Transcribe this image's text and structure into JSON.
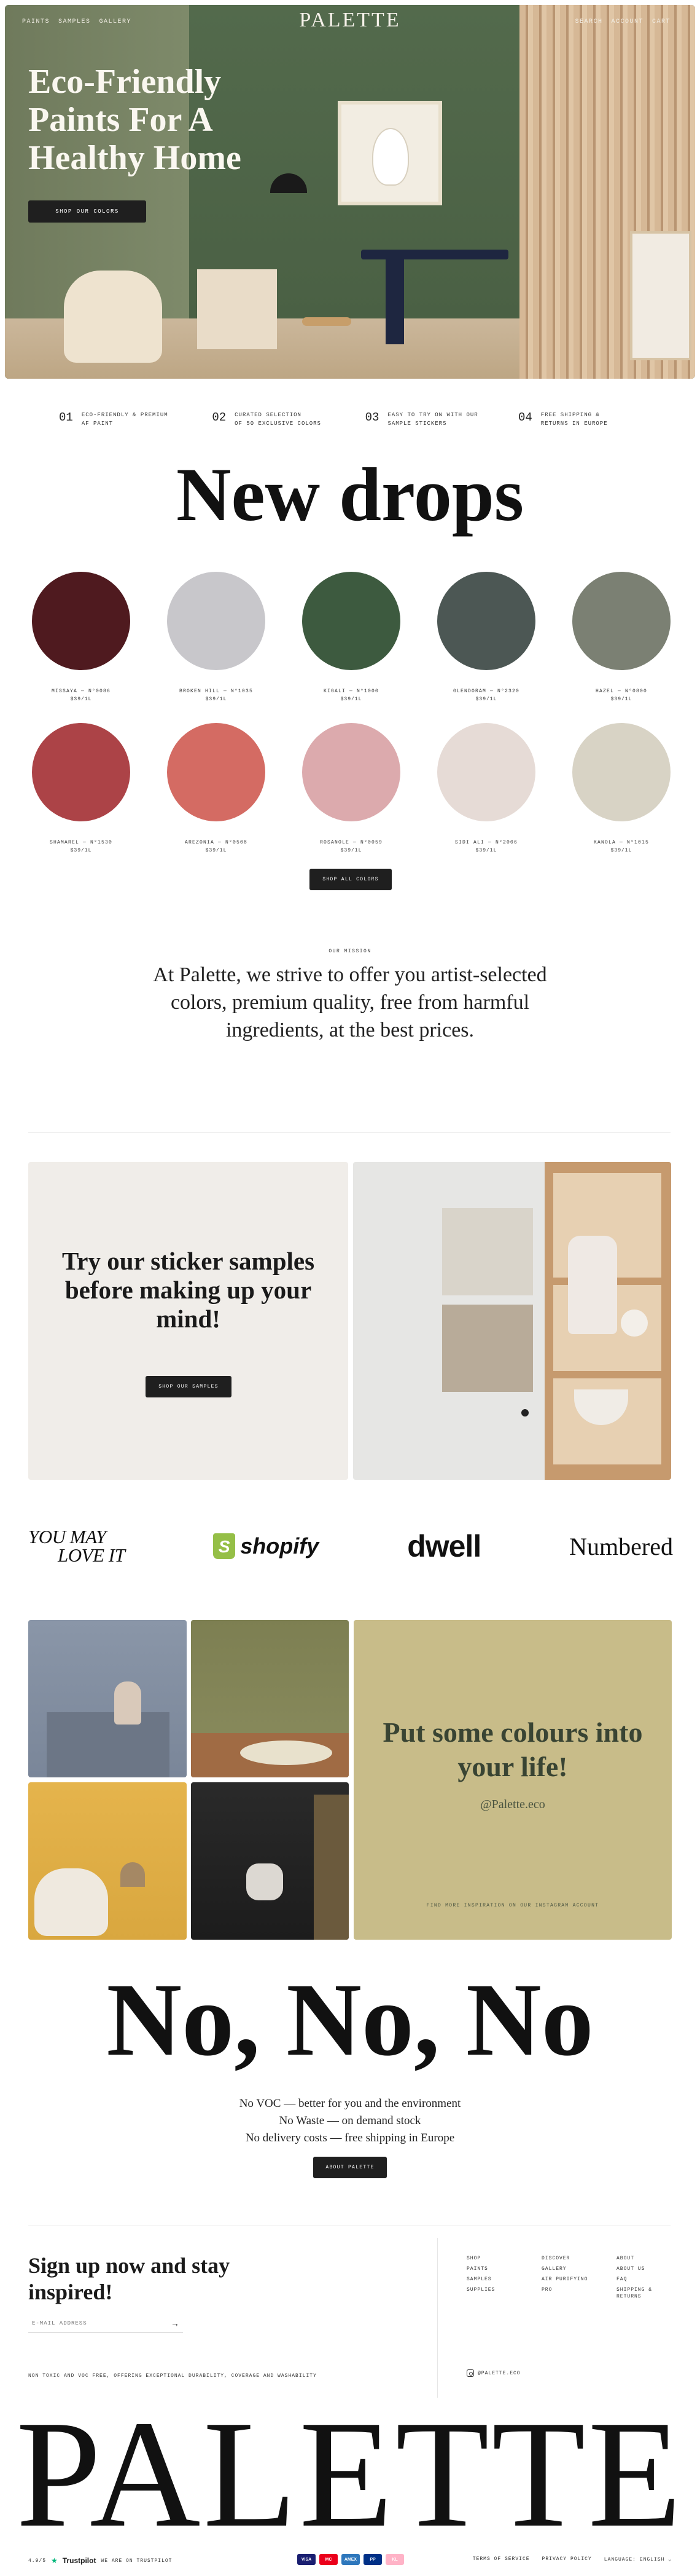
{
  "hero": {
    "nav_left": [
      "PAINTS",
      "SAMPLES",
      "GALLERY"
    ],
    "logo": "PALETTE",
    "nav_right": [
      "SEARCH",
      "ACCOUNT",
      "CART"
    ],
    "title": "Eco-Friendly Paints For A Healthy Home",
    "cta": "SHOP OUR COLORS"
  },
  "features": [
    {
      "num": "01",
      "text": "ECO-FRIENDLY & PREMIUM\nAF PAINT"
    },
    {
      "num": "02",
      "text": "CURATED SELECTION\nOF 50 EXCLUSIVE COLORS"
    },
    {
      "num": "03",
      "text": "EASY TO TRY ON WITH OUR\nSAMPLE STICKERS"
    },
    {
      "num": "04",
      "text": "FREE SHIPPING &\nRETURNS IN EUROPE"
    }
  ],
  "drops": {
    "title": "New drops",
    "swatches": [
      {
        "name": "MISSAYA — N°0086",
        "price": "$39/1L",
        "color": "#4f1a1f"
      },
      {
        "name": "BROKEN HILL — N°1035",
        "price": "$39/1L",
        "color": "#c8c7cb"
      },
      {
        "name": "KIGALI — N°1000",
        "price": "$39/1L",
        "color": "#3d5a3f"
      },
      {
        "name": "GLENDORAM — N°2320",
        "price": "$39/1L",
        "color": "#4c5754"
      },
      {
        "name": "HAZEL — N°0800",
        "price": "$39/1L",
        "color": "#7b8073"
      },
      {
        "name": "SHAMAREL — N°1530",
        "price": "$39/1L",
        "color": "#ac4347"
      },
      {
        "name": "AREZONIA — N°0508",
        "price": "$39/1L",
        "color": "#d46b63"
      },
      {
        "name": "ROSANOLE — N°0059",
        "price": "$39/1L",
        "color": "#dcaaad"
      },
      {
        "name": "SIDI ALI — N°2006",
        "price": "$39/1L",
        "color": "#e6dbd6"
      },
      {
        "name": "KANOLA — N°1015",
        "price": "$39/1L",
        "color": "#d8d3c5"
      }
    ],
    "cta": "SHOP ALL COLORS"
  },
  "mission": {
    "label": "OUR MISSION",
    "text": "At Palette, we strive to offer you artist-selected colors, premium quality, free from harmful ingredients, at the best prices."
  },
  "sticker": {
    "title": "Try our sticker samples before making up your mind!",
    "cta": "SHOP OUR SAMPLES"
  },
  "press": {
    "ymli_line1": "YOU MAY",
    "ymli_line2": "LOVE IT",
    "shopify": "shopify",
    "shopify_glyph": "S",
    "dwell": "dwell",
    "numbered": "Numbered"
  },
  "instagram": {
    "title": "Put some colours into your life!",
    "handle": "@Palette.eco",
    "footnote": "FIND MORE INSPIRATION ON OUR INSTAGRAM ACCOUNT"
  },
  "nonono": {
    "title": "No, No, No",
    "lines": [
      "No VOC — better for you and the environment",
      "No Waste — on demand stock",
      "No delivery costs — free shipping in Europe"
    ],
    "cta": "ABOUT PALETTE"
  },
  "footer": {
    "signup_title": "Sign up now and stay inspired!",
    "email_placeholder": "E-MAIL ADDRESS",
    "arrow": "→",
    "tagline": "NON TOXIC AND VOC FREE, OFFERING EXCEPTIONAL DURABILITY, COVERAGE AND WASHABILITY",
    "col1": [
      "SHOP",
      "PAINTS",
      "SAMPLES",
      "SUPPLIES"
    ],
    "col2": [
      "DISCOVER",
      "GALLERY",
      "AIR PURIFYING",
      "PRO"
    ],
    "col3": [
      "ABOUT",
      "ABOUT US",
      "FAQ",
      "SHIPPING & RETURNS"
    ],
    "instagram": "@PALETTE.ECO",
    "big_logo": "PALETTE",
    "rating": "4.9/5",
    "trust_brand": "Trustpilot",
    "trust_note": "WE ARE ON TRUSTPILOT",
    "payments": [
      {
        "label": "VISA",
        "color": "#1a1f71"
      },
      {
        "label": "MC",
        "color": "#eb001b"
      },
      {
        "label": "AMEX",
        "color": "#2e77bc"
      },
      {
        "label": "PP",
        "color": "#003087"
      },
      {
        "label": "KL",
        "color": "#ffb3c7"
      }
    ],
    "legal": [
      "TERMS OF SERVICE",
      "PRIVACY POLICY",
      "LANGUAGE: ENGLISH ⌄"
    ]
  }
}
